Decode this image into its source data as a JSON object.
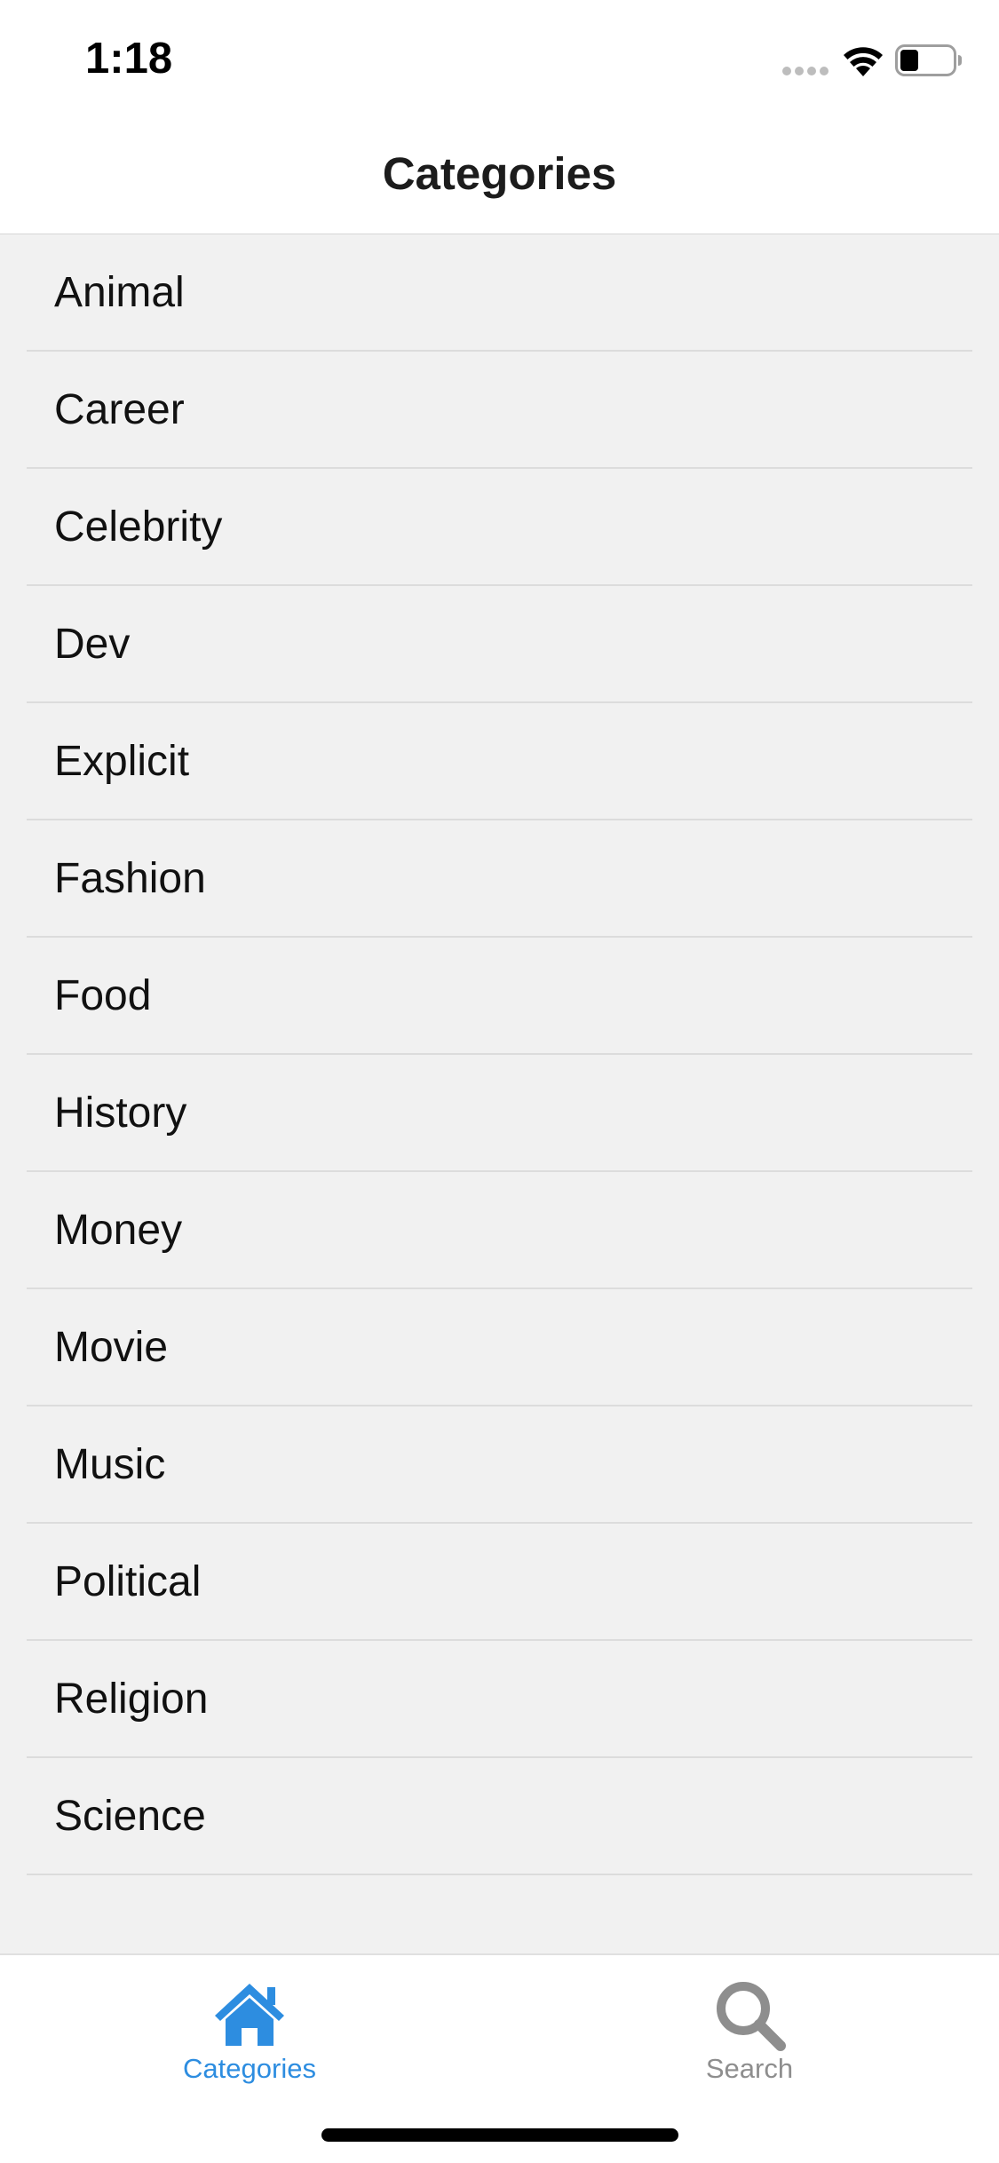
{
  "status_bar": {
    "time": "1:18",
    "signal_icon": "signal-dots-icon",
    "wifi_icon": "wifi-icon",
    "battery_icon": "battery-icon",
    "battery_level": 0.35
  },
  "nav": {
    "title": "Categories"
  },
  "categories": [
    "Animal",
    "Career",
    "Celebrity",
    "Dev",
    "Explicit",
    "Fashion",
    "Food",
    "History",
    "Money",
    "Movie",
    "Music",
    "Political",
    "Religion",
    "Science"
  ],
  "tab_bar": {
    "tabs": [
      {
        "label": "Categories",
        "icon": "home-icon",
        "active": true,
        "color": "#2d8de0"
      },
      {
        "label": "Search",
        "icon": "search-icon",
        "active": false,
        "color": "#8e8e8e"
      }
    ]
  },
  "colors": {
    "accent": "#2d8de0",
    "list_background": "#f1f1f1",
    "separator": "#dcdcdc",
    "inactive_tab": "#8e8e8e"
  }
}
